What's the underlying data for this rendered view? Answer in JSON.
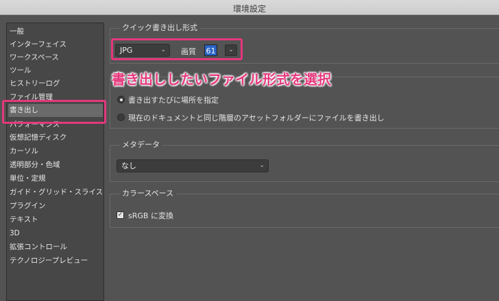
{
  "window": {
    "title": "環境設定"
  },
  "sidebar": {
    "items": [
      {
        "label": "一般"
      },
      {
        "label": "インターフェイス"
      },
      {
        "label": "ワークスペース"
      },
      {
        "label": "ツール"
      },
      {
        "label": "ヒストリーログ"
      },
      {
        "label": "ファイル管理"
      },
      {
        "label": "書き出し",
        "selected": true
      },
      {
        "label": "パフォーマンス"
      },
      {
        "label": "仮想記憶ディスク"
      },
      {
        "label": "カーソル"
      },
      {
        "label": "透明部分・色域"
      },
      {
        "label": "単位・定規"
      },
      {
        "label": "ガイド・グリッド・スライス"
      },
      {
        "label": "プラグイン"
      },
      {
        "label": "テキスト"
      },
      {
        "label": "3D"
      },
      {
        "label": "拡張コントロール"
      },
      {
        "label": "テクノロジープレビュー"
      }
    ]
  },
  "quick_export": {
    "title": "クイック書き出し形式",
    "format": "JPG",
    "quality_label": "画質",
    "quality_value": "61"
  },
  "annotation": {
    "text": "書き出ししたいファイル形式を選択"
  },
  "export_location": {
    "options": [
      {
        "label": "書き出すたびに場所を指定",
        "checked": true
      },
      {
        "label": "現在のドキュメントと同じ階層のアセットフォルダーにファイルを書き出し",
        "checked": false
      }
    ]
  },
  "metadata": {
    "title": "メタデータ",
    "value": "なし"
  },
  "color_space": {
    "title": "カラースペース",
    "convert_label": "sRGB に変換",
    "checked": true
  },
  "colors": {
    "highlight": "#e5387d",
    "selection_blue": "#2a64c5"
  },
  "icons": {
    "dropdown": "chevron-down-icon",
    "check": "checkmark-icon"
  }
}
